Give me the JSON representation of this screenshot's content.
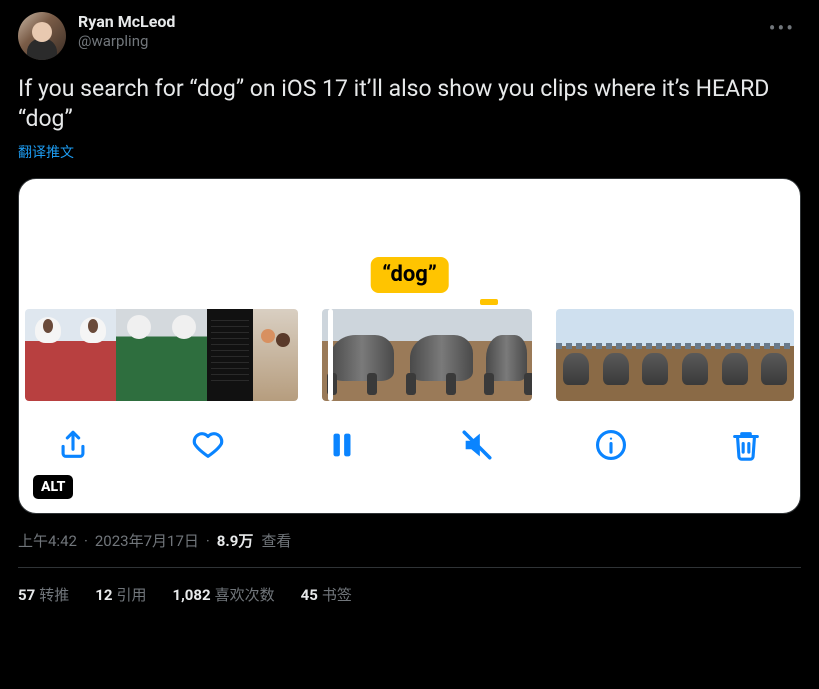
{
  "author": {
    "display_name": "Ryan McLeod",
    "handle": "@warpling"
  },
  "tweet_text": "If you search for “dog” on iOS 17 it’ll also show you clips where it’s HEARD “dog”",
  "translate_label": "翻译推文",
  "media": {
    "search_badge": "“dog”",
    "alt_label": "ALT"
  },
  "meta": {
    "time": "上午4:42",
    "date": "2023年7月17日",
    "views_count": "8.9万",
    "views_label": "查看"
  },
  "stats": {
    "retweets": {
      "count": "57",
      "label": "转推"
    },
    "quotes": {
      "count": "12",
      "label": "引用"
    },
    "likes": {
      "count": "1,082",
      "label": "喜欢次数"
    },
    "bookmarks": {
      "count": "45",
      "label": "书签"
    }
  }
}
